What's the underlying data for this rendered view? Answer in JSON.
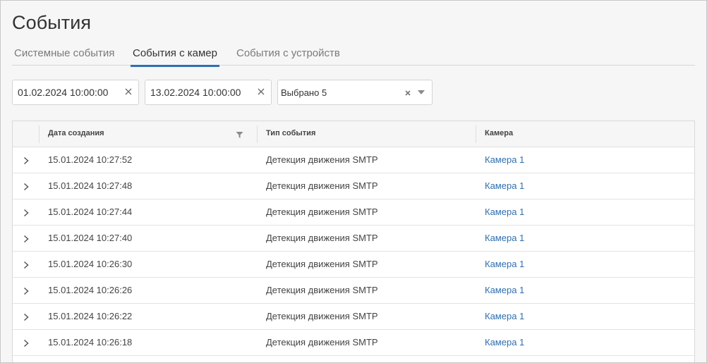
{
  "page": {
    "title": "События"
  },
  "tabs": [
    {
      "label": "Системные события",
      "active": false
    },
    {
      "label": "События с камер",
      "active": true
    },
    {
      "label": "События с устройств",
      "active": false
    }
  ],
  "filters": {
    "date_from": {
      "value": "01.02.2024 10:00:00",
      "clear_icon": "close-icon"
    },
    "date_to": {
      "value": "13.02.2024 10:00:00",
      "clear_icon": "close-icon"
    },
    "event_types": {
      "value": "Выбрано 5",
      "clear_icon": "close-icon",
      "dropdown_icon": "caret-down-icon"
    }
  },
  "table": {
    "columns": [
      "Дата создания",
      "Тип события",
      "Камера"
    ],
    "sort_filter_icon": "filter-icon",
    "rows": [
      {
        "date": "15.01.2024 10:27:52",
        "type": "Детекция движения SMTP",
        "camera": "Камера 1"
      },
      {
        "date": "15.01.2024 10:27:48",
        "type": "Детекция движения SMTP",
        "camera": "Камера 1"
      },
      {
        "date": "15.01.2024 10:27:44",
        "type": "Детекция движения SMTP",
        "camera": "Камера 1"
      },
      {
        "date": "15.01.2024 10:27:40",
        "type": "Детекция движения SMTP",
        "camera": "Камера 1"
      },
      {
        "date": "15.01.2024 10:26:30",
        "type": "Детекция движения SMTP",
        "camera": "Камера 1"
      },
      {
        "date": "15.01.2024 10:26:26",
        "type": "Детекция движения SMTP",
        "camera": "Камера 1"
      },
      {
        "date": "15.01.2024 10:26:22",
        "type": "Детекция движения SMTP",
        "camera": "Камера 1"
      },
      {
        "date": "15.01.2024 10:26:18",
        "type": "Детекция движения SMTP",
        "camera": "Камера 1"
      }
    ]
  },
  "colors": {
    "accent": "#2f6fb0",
    "link": "#2f6fb0",
    "background": "#f6f6f6"
  }
}
